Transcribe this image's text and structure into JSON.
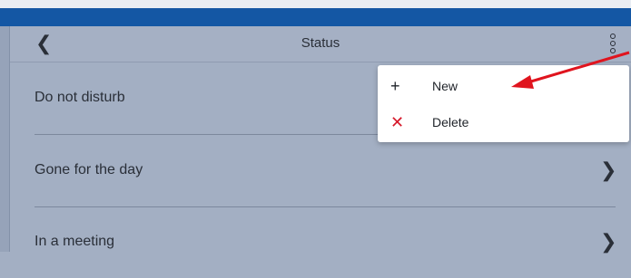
{
  "top_strip": {
    "cutoff_text": ""
  },
  "header": {
    "title": "Status",
    "back_icon": "chevron-left-icon",
    "more_icon": "vertical-ellipsis-icon"
  },
  "rows": [
    {
      "label": "Do not disturb",
      "icon": ""
    },
    {
      "label": "Gone for the day",
      "icon": "chevron-right-icon"
    },
    {
      "label": "In a meeting",
      "icon": "chevron-right-icon"
    }
  ],
  "menu": {
    "items": [
      {
        "label": "New",
        "icon": "plus-icon",
        "icon_color": "#1f2329"
      },
      {
        "label": "Delete",
        "icon": "close-icon",
        "icon_color": "#d6182a"
      }
    ]
  },
  "annotation": {
    "arrow_color": "#e0141e"
  },
  "colors": {
    "brand_bar": "#1457a4",
    "background": "#a3afc3"
  }
}
